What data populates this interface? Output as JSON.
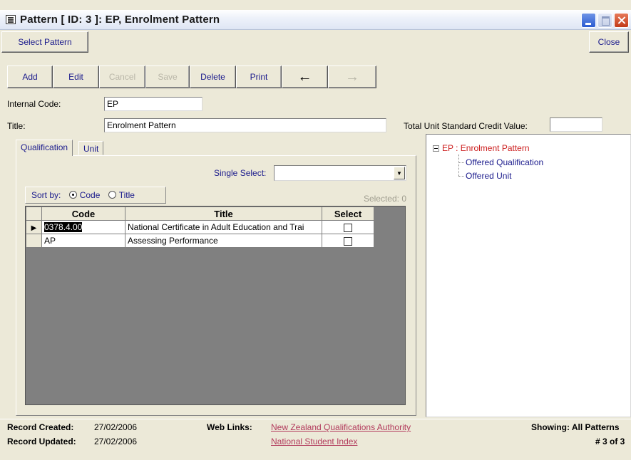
{
  "window": {
    "title": "Pattern [ ID: 3 ]: EP, Enrolment Pattern"
  },
  "top_bar": {
    "select_pattern": "Select Pattern",
    "close": "Close"
  },
  "toolbar": {
    "add": "Add",
    "edit": "Edit",
    "cancel": "Cancel",
    "save": "Save",
    "delete": "Delete",
    "print": "Print",
    "back_icon": "arrow-left-icon",
    "forward_icon": "arrow-right-icon"
  },
  "form": {
    "internal_code_label": "Internal Code:",
    "internal_code_value": "EP",
    "title_label": "Title:",
    "title_value": "Enrolment Pattern",
    "credit_label": "Total Unit Standard Credit Value:",
    "credit_value": ""
  },
  "tabs": [
    {
      "label": "Qualification",
      "active": true
    },
    {
      "label": "Unit",
      "active": false
    }
  ],
  "qualification_tab": {
    "single_select_label": "Single Select:",
    "single_select_value": "",
    "sort_by_label": "Sort by:",
    "sort_options": [
      {
        "label": "Code",
        "checked": true
      },
      {
        "label": "Title",
        "checked": false
      }
    ],
    "selected_text": "Selected: 0",
    "grid": {
      "columns": [
        "Code",
        "Title",
        "Select"
      ],
      "rows": [
        {
          "code": "0378.4.00",
          "title": "National Certificate in Adult Education and Trai",
          "select": false,
          "current": true
        },
        {
          "code": "AP",
          "title": "Assessing Performance",
          "select": false,
          "current": false
        }
      ]
    }
  },
  "tree": {
    "root": "EP : Enrolment Pattern",
    "children": [
      "Offered Qualification",
      "Offered Unit"
    ]
  },
  "footer": {
    "created_label": "Record Created:",
    "created_value": "27/02/2006",
    "updated_label": "Record Updated:",
    "updated_value": "27/02/2006",
    "web_links_label": "Web Links:",
    "link_nzqa": "New Zealand Qualifications Authority",
    "link_nsi": "National Student Index",
    "showing": "Showing: All Patterns",
    "record_pos": "# 3 of 3"
  },
  "colors": {
    "button_text": "#1a1a8c",
    "tree_root": "#cc1e1e",
    "link": "#b23a5c",
    "face": "#ece9d8"
  }
}
